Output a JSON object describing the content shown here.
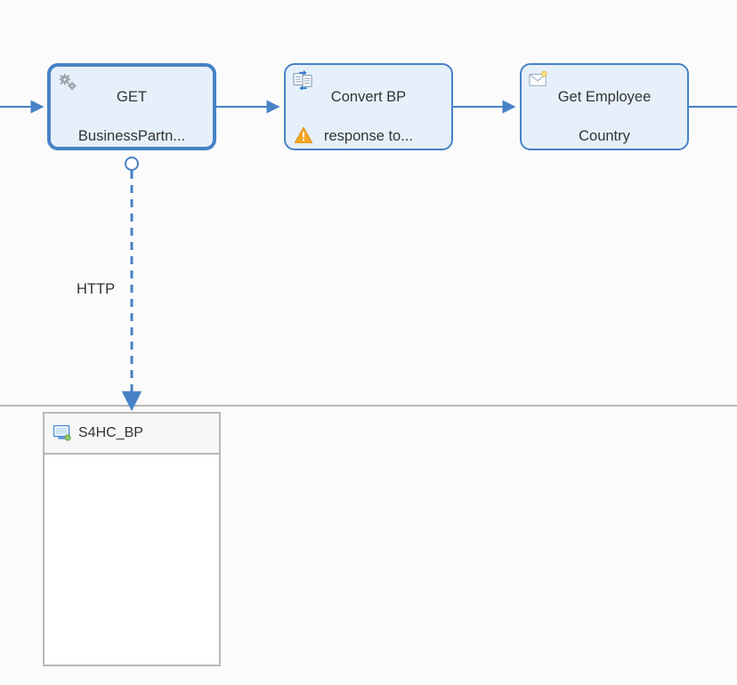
{
  "nodes": {
    "getBP": {
      "line1": "GET",
      "line2": "BusinessPartn..."
    },
    "convert": {
      "line1": "Convert BP",
      "line2": "response to..."
    },
    "country": {
      "line1": "Get Employee",
      "line2": "Country"
    }
  },
  "edge": {
    "http_label": "HTTP"
  },
  "receiver": {
    "title": "S4HC_BP"
  }
}
